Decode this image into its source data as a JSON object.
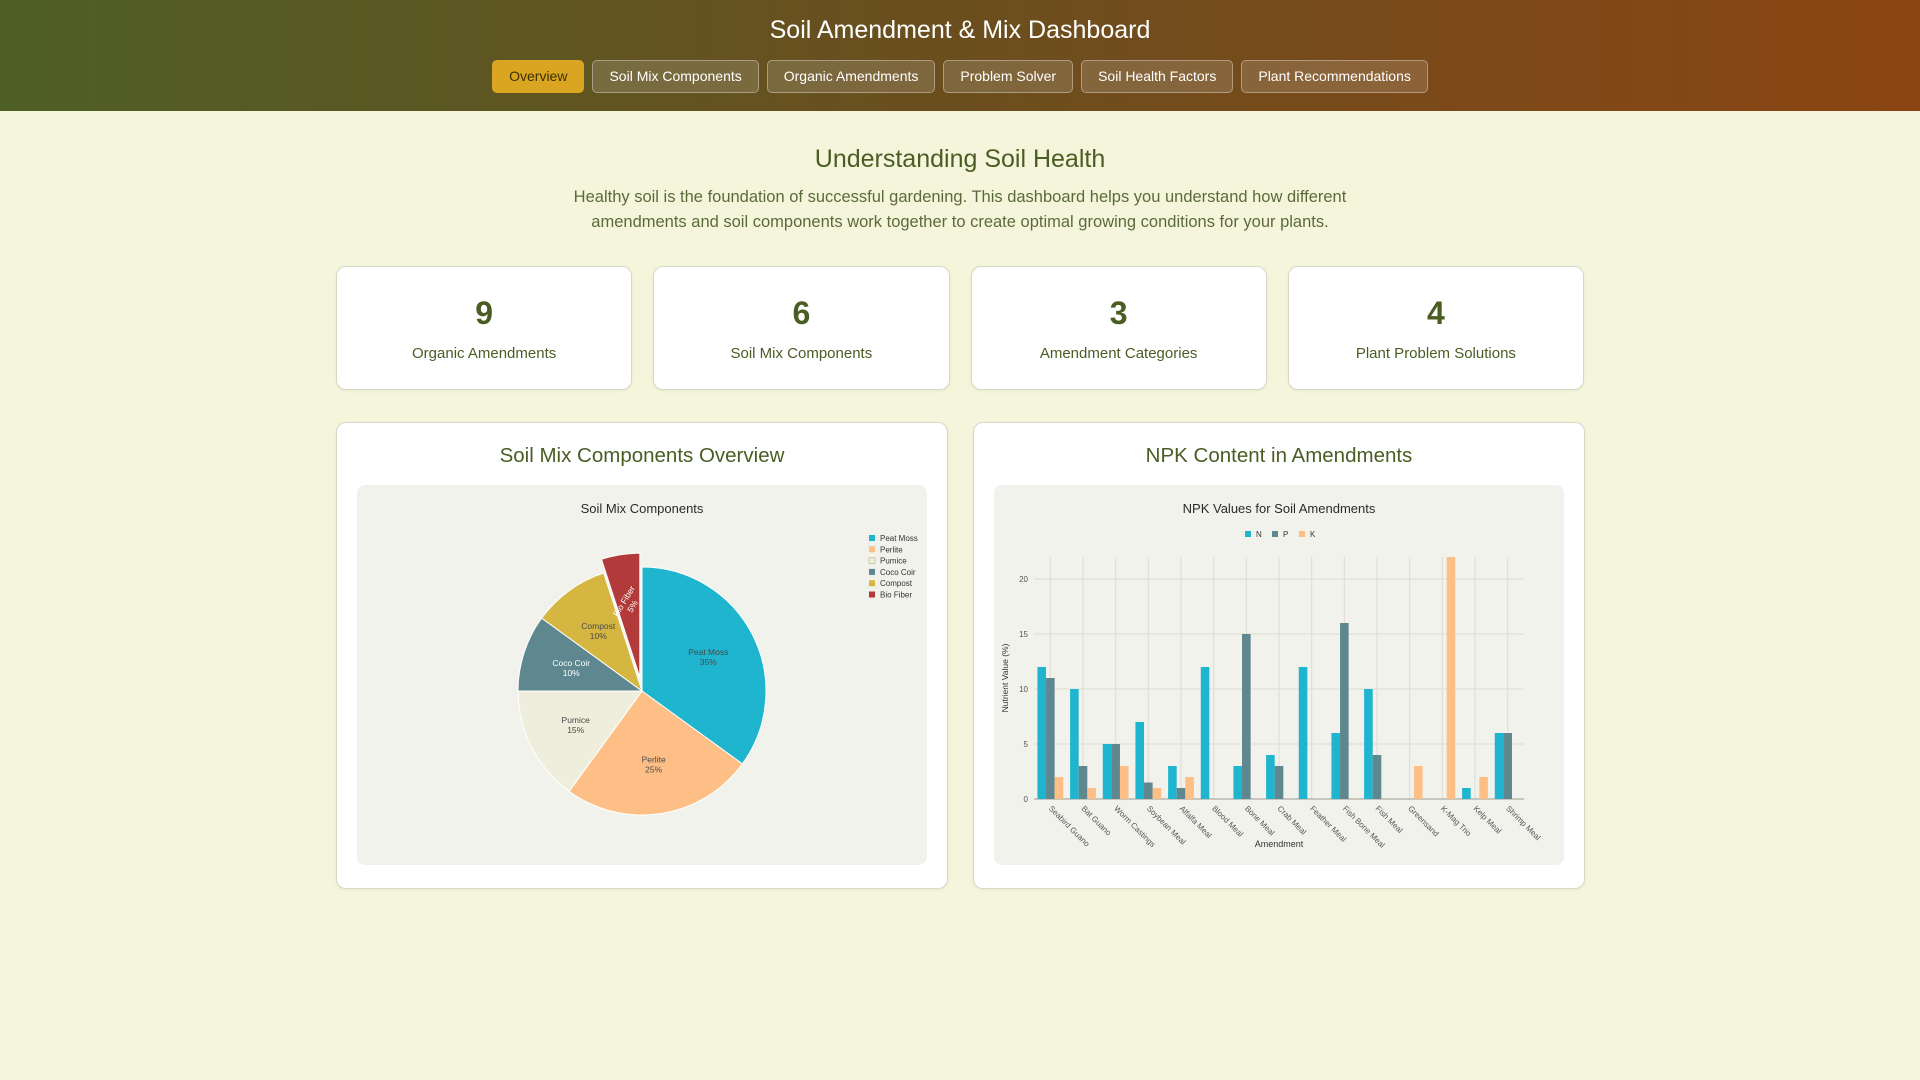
{
  "header": {
    "title": "Soil Amendment & Mix Dashboard",
    "tabs": [
      {
        "label": "Overview",
        "active": true
      },
      {
        "label": "Soil Mix Components",
        "active": false
      },
      {
        "label": "Organic Amendments",
        "active": false
      },
      {
        "label": "Problem Solver",
        "active": false
      },
      {
        "label": "Soil Health Factors",
        "active": false
      },
      {
        "label": "Plant Recommendations",
        "active": false
      }
    ]
  },
  "intro": {
    "heading": "Understanding Soil Health",
    "text": "Healthy soil is the foundation of successful gardening. This dashboard helps you understand how different amendments and soil components work together to create optimal growing conditions for your plants."
  },
  "stats": [
    {
      "value": "9",
      "label": "Organic Amendments"
    },
    {
      "value": "6",
      "label": "Soil Mix Components"
    },
    {
      "value": "3",
      "label": "Amendment Categories"
    },
    {
      "value": "4",
      "label": "Plant Problem Solutions"
    }
  ],
  "cards": {
    "pie_title": "Soil Mix Components Overview",
    "bar_title": "NPK Content in Amendments"
  },
  "colors": {
    "teal": "#1fb5ce",
    "slate": "#5e8790",
    "peach": "#fdbf86",
    "cream": "#efeddb",
    "gold": "#d4b640",
    "red": "#b33a3a",
    "olive": "#4a5d23",
    "active_tab": "#daa520"
  },
  "chart_data": [
    {
      "type": "pie",
      "title": "Soil Mix Components",
      "categories": [
        "Peat Moss",
        "Perlite",
        "Pumice",
        "Coco Coir",
        "Compost",
        "Bio Fiber"
      ],
      "values": [
        35,
        25,
        15,
        10,
        10,
        5
      ],
      "slice_labels": [
        "35%",
        "25%",
        "15%",
        "10%",
        "10%",
        "5%"
      ],
      "colors": [
        "#1fb5ce",
        "#fdbf86",
        "#efeddb",
        "#5e8790",
        "#d4b640",
        "#b33a3a"
      ],
      "pulled": [
        "Bio Fiber"
      ],
      "legend": "top-right"
    },
    {
      "type": "bar",
      "title": "NPK Values for Soil Amendments",
      "xlabel": "Amendment",
      "ylabel": "Nutrient Value (%)",
      "ylim": [
        0,
        22
      ],
      "yticks": [
        0,
        5,
        10,
        15,
        20
      ],
      "grid": true,
      "legend": "top-center",
      "categories": [
        "Seabird Guano",
        "Bat Guano",
        "Worm Castings",
        "Soybean Meal",
        "Alfalfa Meal",
        "Blood Meal",
        "Bone Meal",
        "Crab Meal",
        "Feather Meal",
        "Fish Bone Meal",
        "Fish Meal",
        "Greensand",
        "K-Mag Trio",
        "Kelp Meal",
        "Shrimp Meal"
      ],
      "series": [
        {
          "name": "N",
          "color": "#1fb5ce",
          "values": [
            12,
            10,
            5,
            7,
            3,
            12,
            3,
            4,
            12,
            6,
            10,
            0,
            0,
            1,
            6
          ]
        },
        {
          "name": "P",
          "color": "#5e8790",
          "values": [
            11,
            3,
            5,
            1.5,
            1,
            0,
            15,
            3,
            0,
            16,
            4,
            0,
            0,
            0,
            6
          ]
        },
        {
          "name": "K",
          "color": "#fdbf86",
          "values": [
            2,
            1,
            3,
            1,
            2,
            0,
            0,
            0,
            0,
            0,
            0,
            3,
            22,
            2,
            0
          ]
        }
      ]
    }
  ]
}
